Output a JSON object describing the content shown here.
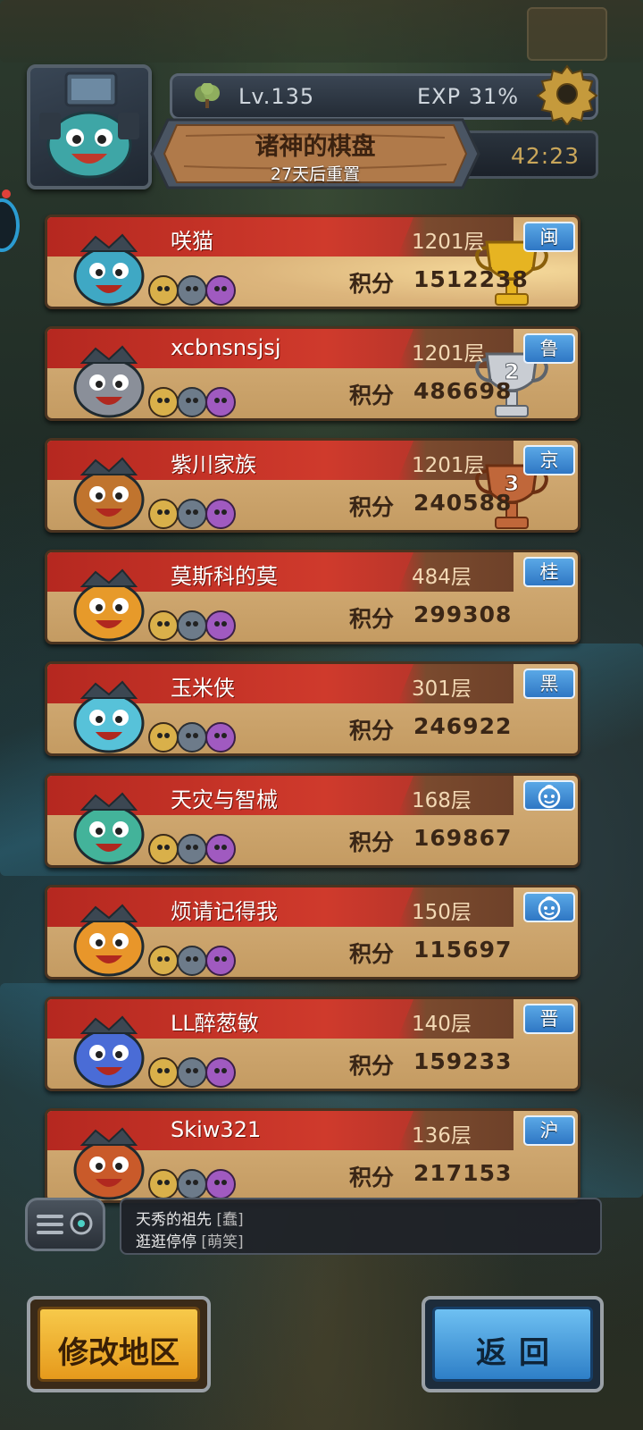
{
  "header": {
    "level": "Lv.135",
    "exp": "EXP 31%",
    "timer": "42:23",
    "event_title": "诸神的棋盘",
    "event_subtitle": "27天后重置"
  },
  "rankings": [
    {
      "name": "咲猫",
      "floor": "1201层",
      "region": "闽",
      "score_label": "积分",
      "score": "1512238",
      "trophy": "gold",
      "accent": "#3fa8c4"
    },
    {
      "name": "xcbnsnsjsj",
      "floor": "1201层",
      "region": "鲁",
      "score_label": "积分",
      "score": "486698",
      "trophy": "silver",
      "accent": "#8a8f99"
    },
    {
      "name": "紫川家族",
      "floor": "1201层",
      "region": "京",
      "score_label": "积分",
      "score": "240588",
      "trophy": "bronze",
      "accent": "#c0742e"
    },
    {
      "name": "莫斯科的莫",
      "floor": "484层",
      "region": "桂",
      "score_label": "积分",
      "score": "299308",
      "trophy": "",
      "accent": "#e79a2a"
    },
    {
      "name": "玉米侠",
      "floor": "301层",
      "region": "黑",
      "score_label": "积分",
      "score": "246922",
      "trophy": "",
      "accent": "#57c2d9"
    },
    {
      "name": "天灾与智械",
      "floor": "168层",
      "region": "",
      "score_label": "积分",
      "score": "169867",
      "trophy": "",
      "accent": "#43b39a"
    },
    {
      "name": "烦请记得我",
      "floor": "150层",
      "region": "",
      "score_label": "积分",
      "score": "115697",
      "trophy": "",
      "accent": "#e8962a"
    },
    {
      "name": "LL醉葱敏",
      "floor": "140层",
      "region": "晋",
      "score_label": "积分",
      "score": "159233",
      "trophy": "",
      "accent": "#4a6cd6"
    },
    {
      "name": "Skiw321",
      "floor": "136层",
      "region": "沪",
      "score_label": "积分",
      "score": "217153",
      "trophy": "",
      "accent": "#c95a2a"
    }
  ],
  "chat": {
    "line1_text": "天秀的祖先",
    "line1_tag": "[蠢]",
    "line2_text": "逛逛停停",
    "line2_tag": "[萌笑]"
  },
  "buttons": {
    "change_region": "修改地区",
    "back": "返回"
  },
  "colors": {
    "card_bg": "#d6b07a",
    "name_band": "#c0302a",
    "region_badge": "#3f8fd6",
    "gold_button": "#f2b733",
    "blue_button": "#4aa3e3"
  }
}
